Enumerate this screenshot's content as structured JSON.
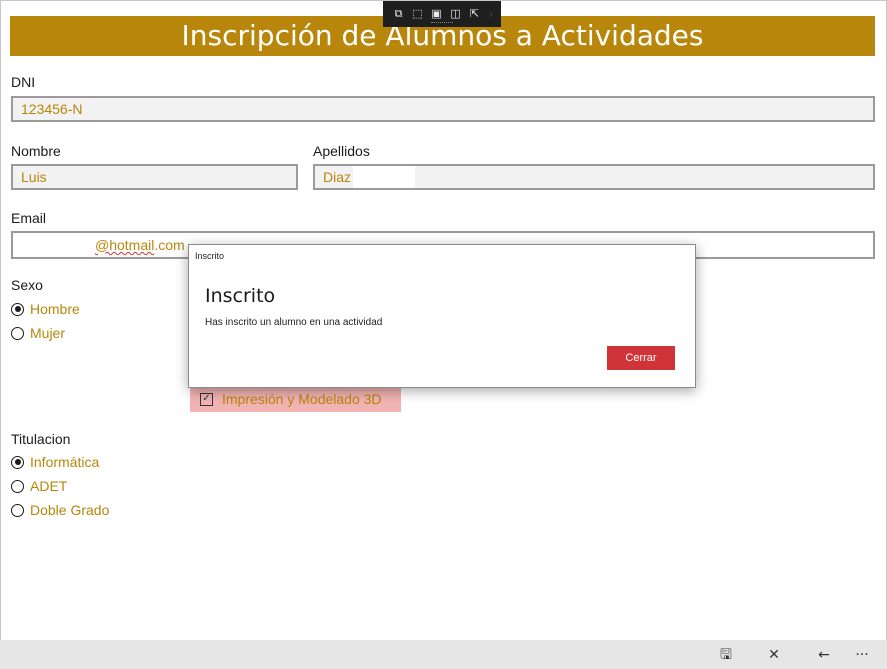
{
  "app": {
    "title": "Inscripción de Alumnos a Actividades"
  },
  "debug_toolbar": {
    "icons": [
      "live-visual-tree-icon",
      "select-element-icon",
      "display-layout-adorners-icon",
      "track-focused-element-icon",
      "hot-reload-icon"
    ]
  },
  "form": {
    "dni": {
      "label": "DNI",
      "value": "123456-N"
    },
    "nombre": {
      "label": "Nombre",
      "value": "Luis"
    },
    "apellidos": {
      "label": "Apellidos",
      "value": "Diaz"
    },
    "email": {
      "label": "Email",
      "value_prefix": "@hotmail",
      "value_suffix": ".com"
    },
    "sexo": {
      "label": "Sexo",
      "options": [
        {
          "label": "Hombre",
          "selected": true
        },
        {
          "label": "Mujer",
          "selected": false
        }
      ]
    },
    "actividad": {
      "label": "Impresión y Modelado 3D",
      "checked": true
    },
    "titulacion": {
      "label": "Titulacion",
      "options": [
        {
          "label": "Informática",
          "selected": true
        },
        {
          "label": "ADET",
          "selected": false
        },
        {
          "label": "Doble Grado",
          "selected": false
        }
      ]
    }
  },
  "dialog": {
    "caption": "Inscrito",
    "title": "Inscrito",
    "message": "Has inscrito un alumno en una actividad",
    "close_label": "Cerrar"
  },
  "app_bar": {
    "icons": [
      "save-icon",
      "close-icon",
      "back-arrow-icon",
      "more-icon"
    ],
    "glyphs": {
      "save": "🖫",
      "close": "✕",
      "back": "←",
      "more": "···"
    }
  },
  "colors": {
    "accent": "#b8860b",
    "title_bar": "#b8860b",
    "checkbox_highlight": "#f2b3b3",
    "dialog_button": "#d13438",
    "app_bar": "#e6e6e6"
  }
}
